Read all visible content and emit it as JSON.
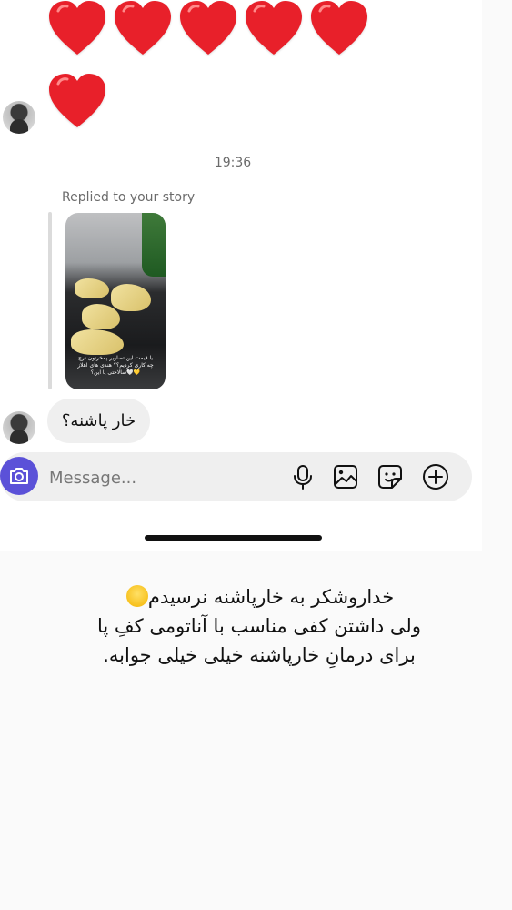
{
  "thread": {
    "hearts_row1": [
      "❤",
      "❤",
      "❤",
      "❤",
      "❤"
    ],
    "hearts_row2": [
      "❤"
    ],
    "timestamp": "19:36",
    "reply_label": "Replied to your story",
    "story_caption": "یا قیمت این تصاویر پمخرتون نرچ چه کاری کردیم؟؟ هندی های اهلاز سالاحتی یا این؟🤍💛",
    "incoming_message": "خار پاشنه؟"
  },
  "composer": {
    "placeholder": "Message...",
    "icons": [
      "camera-icon",
      "microphone-icon",
      "gallery-icon",
      "sticker-icon",
      "add-icon"
    ]
  },
  "caption": {
    "line1": "خداروشکر به خارپاشنه نرسیدم",
    "line2": "ولی  داشتن کفی مناسب با  آناتومی کفِ پا",
    "line3": "برای درمانِ خارپاشنه خیلی خیلی جوابه."
  },
  "colors": {
    "heart": "#e8202a",
    "camera_button": "#5b51d8",
    "bubble": "#efefef",
    "composer": "#efefef",
    "meta_text": "#6b6b6b"
  }
}
